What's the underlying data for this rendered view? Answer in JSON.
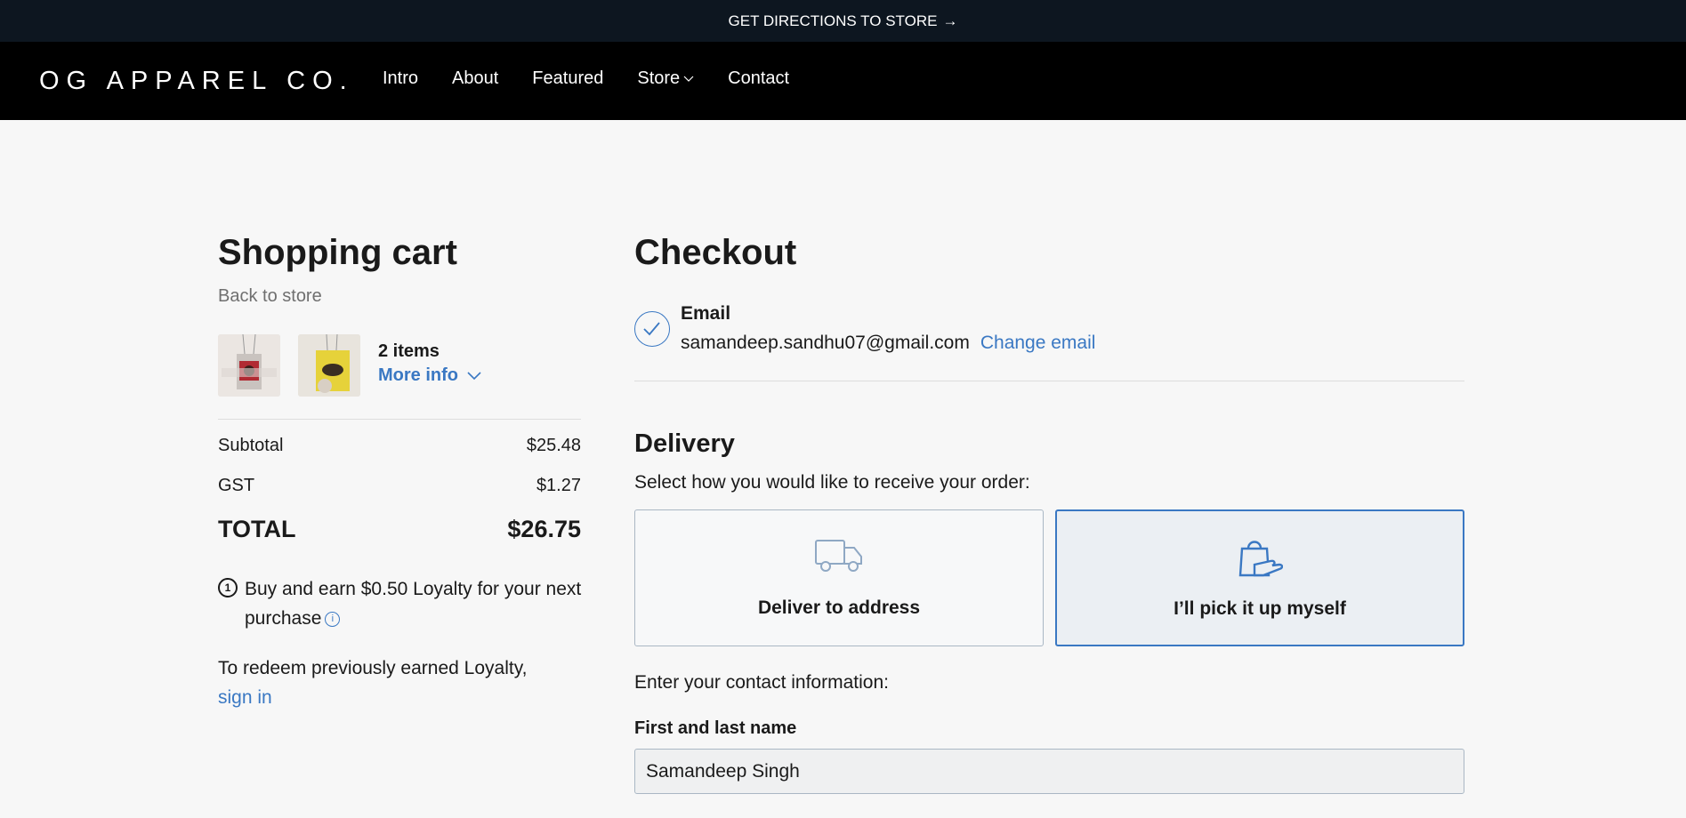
{
  "announcement": {
    "text": "GET DIRECTIONS TO STORE",
    "arrow": "→"
  },
  "nav": {
    "logo": "OG APPAREL CO.",
    "links": [
      "Intro",
      "About",
      "Featured",
      "Store",
      "Contact"
    ],
    "dropdown_icon": "chevron-down-icon"
  },
  "cart": {
    "title": "Shopping cart",
    "back_label": "Back to store",
    "items_count": "2 items",
    "more_info": "More info",
    "subtotal_label": "Subtotal",
    "subtotal_value": "$25.48",
    "gst_label": "GST",
    "gst_value": "$1.27",
    "total_label": "TOTAL",
    "total_value": "$26.75",
    "loyalty_icon": "loyalty-coin-icon",
    "loyalty_text": "Buy and earn $0.50 Loyalty for your next purchase",
    "redeem_text": "To redeem previously earned Loyalty,",
    "signin_label": "sign in"
  },
  "checkout": {
    "title": "Checkout",
    "email_label": "Email",
    "email_value": "samandeep.sandhu07@gmail.com",
    "change_email": "Change email",
    "delivery_title": "Delivery",
    "delivery_prompt": "Select how you would like to receive your order:",
    "options": [
      {
        "label": "Deliver to address",
        "icon": "truck-icon",
        "selected": false
      },
      {
        "label": "I’ll pick it up myself",
        "icon": "shopping-bag-hand-icon",
        "selected": true
      }
    ],
    "contact_prompt": "Enter your contact information:",
    "name_label": "First and last name",
    "name_value": "Samandeep Singh"
  },
  "colors": {
    "accent": "#3a78c3",
    "topbar": "#0d1620",
    "nav": "#000000",
    "background": "#f7f7f7"
  }
}
